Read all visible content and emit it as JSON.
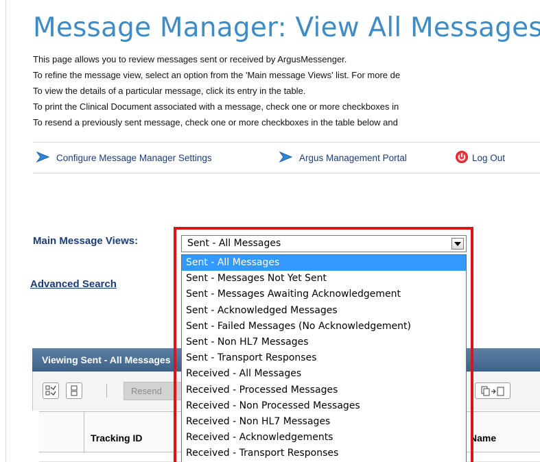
{
  "page": {
    "title": "Message Manager: View All Messages",
    "intro_lines": [
      "This page allows you to review messages sent or received by ArgusMessenger.",
      "To refine the message view, select an option from the 'Main message Views' list. For more de",
      "To view the details of a particular message, click its entry in the table.",
      "To print the Clinical Document associated with a message, check one or more checkboxes in",
      "To resend a previously sent message, check one or more checkboxes in the table below and"
    ]
  },
  "toolbar": {
    "configure_label": "Configure Message Manager Settings",
    "portal_label": "Argus Management Portal",
    "logout_label": "Log Out"
  },
  "views": {
    "label": "Main Message Views:",
    "selected": "Sent - All Messages",
    "options": [
      "Sent - All Messages",
      "Sent - Messages Not Yet Sent",
      "Sent - Messages Awaiting Acknowledgement",
      "Sent - Acknowledged Messages",
      "Sent - Failed Messages (No Acknowledgement)",
      "Sent - Non HL7 Messages",
      "Sent - Transport Responses",
      "Received - All Messages",
      "Received - Processed Messages",
      "Received - Non Processed Messages",
      "Received - Non HL7 Messages",
      "Received - Acknowledgements",
      "Received - Transport Responses"
    ],
    "selected_index": 0
  },
  "search": {
    "advanced_label": "Advanced Search"
  },
  "panel": {
    "title": "Viewing Sent - All Messages",
    "resend_label": "Resend",
    "columns": {
      "tracking_id": "Tracking ID",
      "name": "Name"
    }
  },
  "colors": {
    "title_blue": "#3f8cc5",
    "link_navy": "#1a3c78",
    "highlight_red": "#d8151b",
    "selected_option": "#3399ff",
    "panel_header": "#4a6f95"
  },
  "icons": {
    "configure": "blue-chevron-icon",
    "portal": "blue-chevron-icon",
    "logout": "power-icon",
    "select_arrow": "triangle-down-icon"
  }
}
